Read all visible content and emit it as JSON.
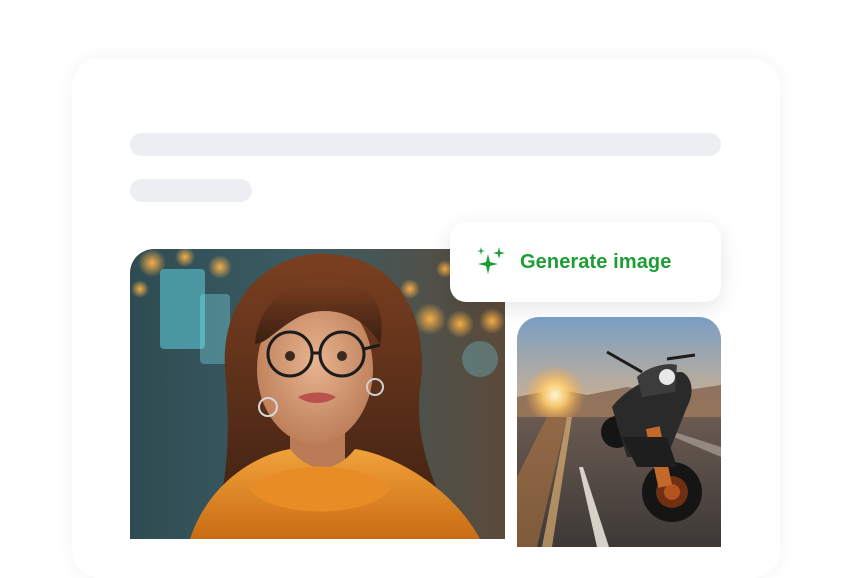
{
  "generate_button": {
    "label": "Generate image",
    "icon": "sparkles-icon",
    "color": "#1f9d35"
  },
  "images": [
    {
      "icon": "portrait-photo"
    },
    {
      "icon": "motorcycle-photo"
    }
  ],
  "colors": {
    "skeleton": "#eceef1",
    "background": "#ffffff"
  }
}
